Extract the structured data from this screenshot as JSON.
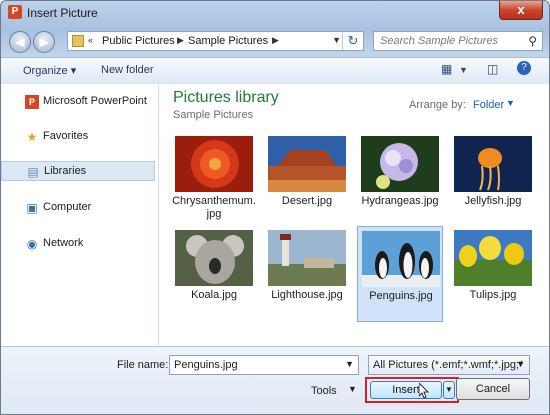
{
  "window": {
    "title": "Insert Picture",
    "close_symbol": "x"
  },
  "address": {
    "prefix": "«",
    "crumbs": [
      "Public Pictures",
      "Sample Pictures"
    ]
  },
  "search": {
    "placeholder": "Search Sample Pictures"
  },
  "toolbar": {
    "organize": "Organize",
    "new_folder": "New folder"
  },
  "nav_pane": {
    "items": [
      {
        "label": "Microsoft PowerPoint",
        "icon": "powerpoint-icon"
      },
      {
        "label": "Favorites",
        "icon": "star-icon"
      },
      {
        "label": "Libraries",
        "icon": "libraries-icon",
        "selected": true
      },
      {
        "label": "Computer",
        "icon": "computer-icon"
      },
      {
        "label": "Network",
        "icon": "network-icon"
      }
    ]
  },
  "library": {
    "title": "Pictures library",
    "subtitle": "Sample Pictures",
    "arrange_label": "Arrange by:",
    "arrange_value": "Folder"
  },
  "files": [
    {
      "name": "Chrysanthemum.\njpg"
    },
    {
      "name": "Desert.jpg"
    },
    {
      "name": "Hydrangeas.jpg"
    },
    {
      "name": "Jellyfish.jpg"
    },
    {
      "name": "Koala.jpg"
    },
    {
      "name": "Lighthouse.jpg"
    },
    {
      "name": "Penguins.jpg",
      "selected": true
    },
    {
      "name": "Tulips.jpg"
    }
  ],
  "bottom": {
    "file_name_label": "File name:",
    "file_name_value": "Penguins.jpg",
    "filter_value": "All Pictures (*.emf;*.wmf;*.jpg;*",
    "tools_label": "Tools",
    "insert_label": "Insert",
    "cancel_label": "Cancel"
  },
  "colors": {
    "library_title": "#1e7b34",
    "highlight_box": "#e01c24",
    "link_blue": "#1f5fb4"
  }
}
